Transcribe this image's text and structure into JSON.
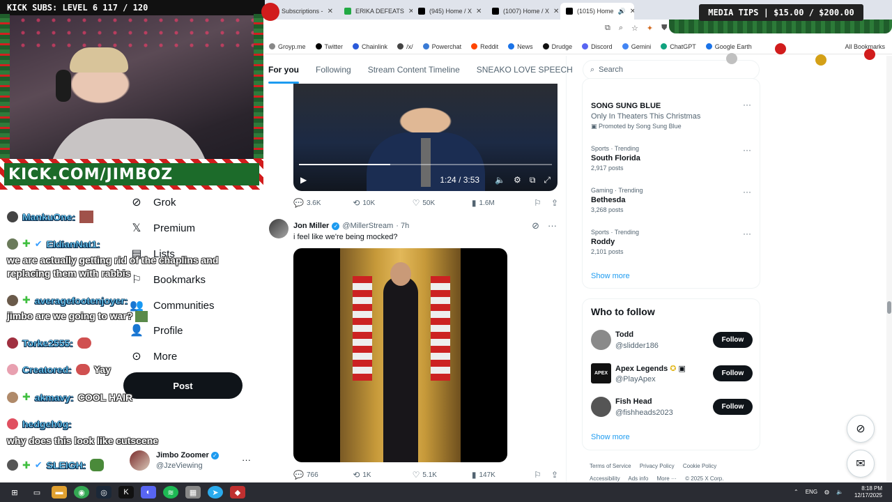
{
  "stream": {
    "kick_subs": "KICK SUBS: LEVEL 6 117 / 120",
    "banner": "KICK.COM/JIMBOZ",
    "media_tips": "MEDIA TIPS | $15.00 / $200.00"
  },
  "chat": [
    {
      "user": "MankuOne:",
      "message": ""
    },
    {
      "user": "EldianNat1:",
      "message": ""
    },
    {
      "user": "averagefootenjoyer:",
      "message": ""
    },
    {
      "user": "Torke2555:",
      "message": ""
    },
    {
      "user": "Creatored:",
      "message": "Yay"
    },
    {
      "user": "akmavy:",
      "message": "COOL HAIR"
    },
    {
      "user": "hedgeh0g:",
      "message": ""
    },
    {
      "user": "SLEIGH:",
      "message": ""
    }
  ],
  "chat_messages": {
    "eldian": "we are actually getting rid of the chaplins and replacing them with rabbis",
    "average": "jimbo are we going to war?",
    "hedge": "why does this look like cutscene"
  },
  "browser": {
    "tabs": [
      {
        "label": "Subscriptions -",
        "color": "#ff0000"
      },
      {
        "label": "ERIKA DEFEATS",
        "color": "#22aa44"
      },
      {
        "label": "(945) Home / X",
        "color": "#000000"
      },
      {
        "label": "(1007) Home / X",
        "color": "#000000"
      },
      {
        "label": "(1015) Home",
        "color": "#000000"
      }
    ],
    "bookmarks": [
      {
        "label": "Groyp.me",
        "color": "#888888"
      },
      {
        "label": "Twitter",
        "color": "#000000"
      },
      {
        "label": "Chainlink",
        "color": "#2a5ada"
      },
      {
        "label": "/x/",
        "color": "#444444"
      },
      {
        "label": "Powerchat",
        "color": "#3a7bd5"
      },
      {
        "label": "Reddit",
        "color": "#ff4500"
      },
      {
        "label": "News",
        "color": "#1a73e8"
      },
      {
        "label": "Drudge",
        "color": "#111111"
      },
      {
        "label": "Discord",
        "color": "#5865f2"
      },
      {
        "label": "Gemini",
        "color": "#4285f4"
      },
      {
        "label": "ChatGPT",
        "color": "#10a37f"
      },
      {
        "label": "Google Earth",
        "color": "#1a73e8"
      }
    ],
    "all_bookmarks": "All Bookmarks"
  },
  "x": {
    "top_tabs": [
      "For you",
      "Following",
      "Stream Content Timeline",
      "SNEAKO LOVE SPEECH"
    ],
    "nav": [
      "Grok",
      "Premium",
      "Lists",
      "Bookmarks",
      "Communities",
      "Profile",
      "More"
    ],
    "post_button": "Post",
    "account": {
      "name": "Jimbo Zoomer",
      "handle": "@JzeViewing"
    },
    "tweet1": {
      "video_time": "1:24 / 3:53",
      "video_progress": 0.36,
      "replies": "3.6K",
      "reposts": "10K",
      "likes": "50K",
      "views": "1.6M"
    },
    "tweet2": {
      "name": "Jon Miller",
      "handle": "@MillerStream",
      "time": "· 7h",
      "text": "i feel like we're being mocked?",
      "replies": "766",
      "reposts": "1K",
      "likes": "5.1K",
      "views": "147K"
    },
    "search_placeholder": "Search",
    "promo": {
      "title": "SONG SUNG BLUE",
      "subtitle": "Only In Theaters This Christmas",
      "promoted": "Promoted by Song Sung Blue"
    },
    "trends": [
      {
        "category": "Sports · Trending",
        "title": "South Florida",
        "posts": "2,917 posts"
      },
      {
        "category": "Gaming · Trending",
        "title": "Bethesda",
        "posts": "3,268 posts"
      },
      {
        "category": "Sports · Trending",
        "title": "Roddy",
        "posts": "2,101 posts"
      }
    ],
    "show_more": "Show more",
    "who_to_follow": "Who to follow",
    "follow_list": [
      {
        "name": "Todd",
        "handle": "@slidder186",
        "color": "#8a8a8a"
      },
      {
        "name": "Apex Legends",
        "handle": "@PlayApex",
        "color": "#111111"
      },
      {
        "name": "Fish Head",
        "handle": "@fishheads2023",
        "color": "#555555"
      }
    ],
    "follow_label": "Follow",
    "footer": [
      "Terms of Service",
      "Privacy Policy",
      "Cookie Policy",
      "Accessibility",
      "Ads info",
      "More ···",
      "© 2025 X Corp."
    ]
  },
  "taskbar": {
    "lang": "ENG",
    "time": "8:18 PM",
    "date": "12/17/2025"
  },
  "colors": {
    "accent": "#1d9bf0",
    "text": "#0f1419",
    "muted": "#536471"
  }
}
